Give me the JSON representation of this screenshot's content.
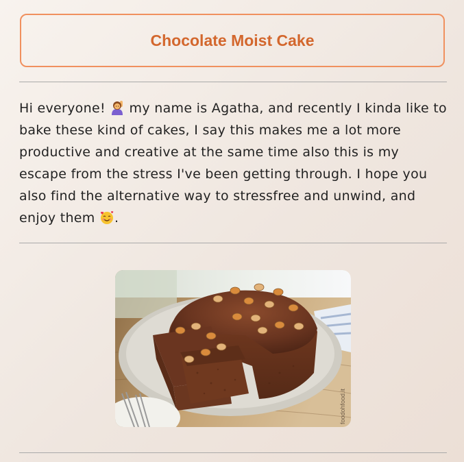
{
  "title": "Chocolate Moist Cake",
  "intro": {
    "part1": "Hi everyone! ",
    "emoji1": "person-raising-hand-icon",
    "part2": " my name is Agatha, and recently I kinda like to bake these kind of cakes, I say this makes me a lot more productive and creative at the same time also this is my escape from the stress I've been getting through. I hope you also find the alternative way to stressfree and unwind, and enjoy them ",
    "emoji2": "smiling-face-with-hearts-icon",
    "part3": "."
  },
  "image": {
    "subject": "chocolate-cake-photo",
    "watermark": "foodohfood.it"
  },
  "colors": {
    "accent": "#d3672d",
    "border": "#f0905e",
    "text": "#222222",
    "divider": "#a9a9a9"
  }
}
